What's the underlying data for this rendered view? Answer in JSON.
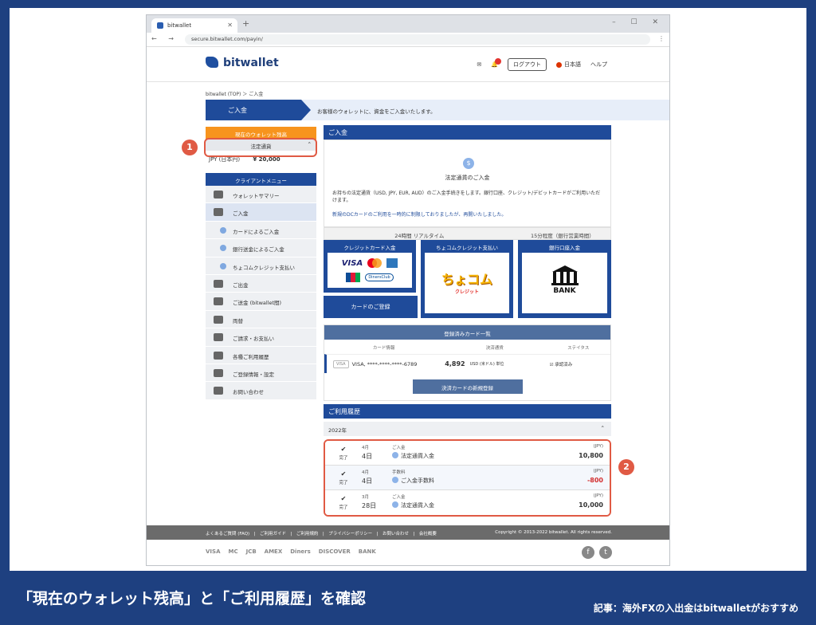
{
  "browser": {
    "tab_title": "bitwallet",
    "url": "secure.bitwallet.com/payin/",
    "nav_buttons": "← → C",
    "win_controls": "– ☐ ✕",
    "new_tab": "+",
    "tab_close": "✕",
    "menu": "⋮"
  },
  "header": {
    "logo_text": "bitwallet",
    "logout": "ログアウト",
    "language": "日本語",
    "help": "ヘルプ"
  },
  "breadcrumb": "bitwallet (TOP) ＞ ご入金",
  "banner": {
    "title": "ご入金",
    "text": "お客様のウォレットに、資金をご入金いたします。"
  },
  "sidebar": {
    "balance_header": "現在のウォレット残高",
    "fiat_label": "法定通貨",
    "balance_currency": "JPY (日本円)",
    "balance_amount": "¥ 20,000",
    "menu_header": "クライアントメニュー",
    "items": [
      {
        "label": "ウォレットサマリー",
        "type": "main"
      },
      {
        "label": "ご入金",
        "type": "active"
      },
      {
        "label": "カードによるご入金",
        "type": "sub"
      },
      {
        "label": "銀行送金によるご入金",
        "type": "sub"
      },
      {
        "label": "ちょコムクレジット支払い",
        "type": "sub"
      },
      {
        "label": "ご出金",
        "type": "main"
      },
      {
        "label": "ご送金 (bitwallet間)",
        "type": "main"
      },
      {
        "label": "両替",
        "type": "main"
      },
      {
        "label": "ご請求・お支払い",
        "type": "main"
      },
      {
        "label": "各種ご利用履歴",
        "type": "main"
      },
      {
        "label": "ご登録情報・設定",
        "type": "main"
      },
      {
        "label": "お問い合わせ",
        "type": "main"
      }
    ]
  },
  "main": {
    "title": "ご入金",
    "coin_symbol": "$",
    "notice_title": "法定通貨のご入金",
    "notice_body": "お持ちの法定通貨（USD, JPY, EUR, AUD）のご入金手続きをします。銀行口座、クレジット/デビットカードがご利用いただけます。",
    "notice_warn": "新規のDCカードのご利用を一時的に制限しておりましたが、再開いたしました。",
    "realtime_label": "24時間 リアルタイム",
    "business_label": "15分程度（銀行営業時間）",
    "credit_card": "クレジットカード入金",
    "card_logos": {
      "visa": "VISA",
      "diners": "DinersClub"
    },
    "register_card": "カードのご登録",
    "chocom": "ちょコムクレジット支払い",
    "chocom_logo": "ちょコム",
    "chocom_sub": "クレジット",
    "bank": "銀行口座入金",
    "bank_logo": "BANK",
    "registered_title": "登録済みカード一覧",
    "rc_columns": [
      "カード情報",
      "決済通貨",
      "ステイタス"
    ],
    "rc_row": {
      "brand": "VISA",
      "number": "VISA, ****-****-****-6789",
      "amount": "4,892",
      "currency": "USD (米ドル) 単位",
      "status": "承認済み"
    },
    "new_card_button": "決済カードの新規登録",
    "history_title": "ご利用履歴",
    "year": "2022年",
    "history": [
      {
        "status": "完了",
        "month": "4月",
        "day": "4日",
        "type": "ご入金",
        "name": "法定通貨入金",
        "currency": "(JPY)",
        "amount": "10,800",
        "neg": false
      },
      {
        "status": "完了",
        "month": "4月",
        "day": "4日",
        "type": "手数料",
        "name": "ご入金手数料",
        "currency": "(JPY)",
        "amount": "-800",
        "neg": true
      },
      {
        "status": "完了",
        "month": "3月",
        "day": "28日",
        "type": "ご入金",
        "name": "法定通貨入金",
        "currency": "(JPY)",
        "amount": "10,000",
        "neg": false
      }
    ]
  },
  "footer": {
    "links": "よくあるご質問 (FAQ)　|　ご利用ガイド　|　ご利用規約　|　プライバシーポリシー　|　お問い合わせ　|　会社概要",
    "copyright": "Copyright © 2013-2022 bitwallet. All rights reserved.",
    "logos": [
      "VISA",
      "MC",
      "JCB",
      "AMEX",
      "Diners",
      "DISCOVER",
      "BANK"
    ],
    "social": [
      "f",
      "t"
    ]
  },
  "annotations": {
    "one": "1",
    "two": "2"
  },
  "caption": "「現在のウォレット残高」と「ご利用履歴」を確認",
  "article": "記事：海外FXの入出金はbitwalletがおすすめ",
  "colors": {
    "brand": "#1f4b9a",
    "accent": "#f7941d",
    "highlight": "#e05a44",
    "background": "#1e4080"
  }
}
